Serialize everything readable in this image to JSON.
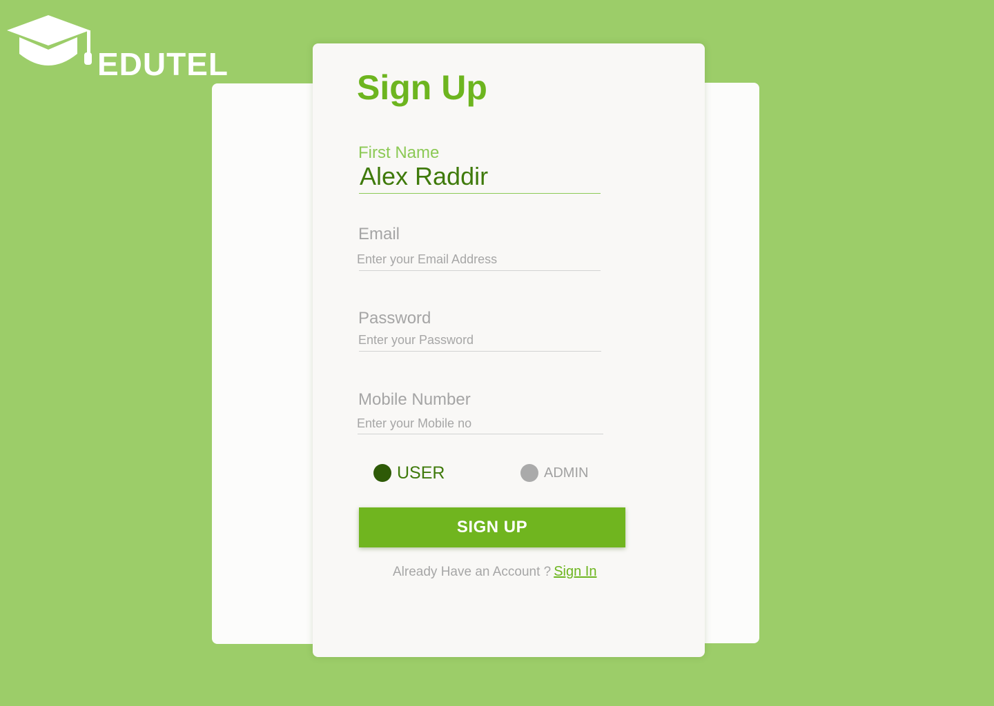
{
  "brand": {
    "name": "EDUTEL",
    "icon": "graduation-cap-icon"
  },
  "form": {
    "title": "Sign Up",
    "first_name": {
      "label": "First Name",
      "value": "Alex Raddir"
    },
    "email": {
      "label": "Email",
      "placeholder": "Enter your Email Address"
    },
    "password": {
      "label": "Password",
      "placeholder": "Enter your Password"
    },
    "mobile": {
      "label": "Mobile Number",
      "placeholder": "Enter your Mobile no"
    },
    "role": {
      "options": [
        "USER",
        "ADMIN"
      ],
      "selected": "USER"
    },
    "submit_label": "SIGN UP",
    "footer": {
      "prompt": "Already Have an Account ?",
      "link": "Sign In"
    }
  },
  "colors": {
    "background": "#9ccd69",
    "accent": "#70b51f",
    "title": "#6db51f",
    "selected_radio": "#2e5a07",
    "unselected_radio": "#aaaaaa",
    "card": "#f9f8f6"
  }
}
